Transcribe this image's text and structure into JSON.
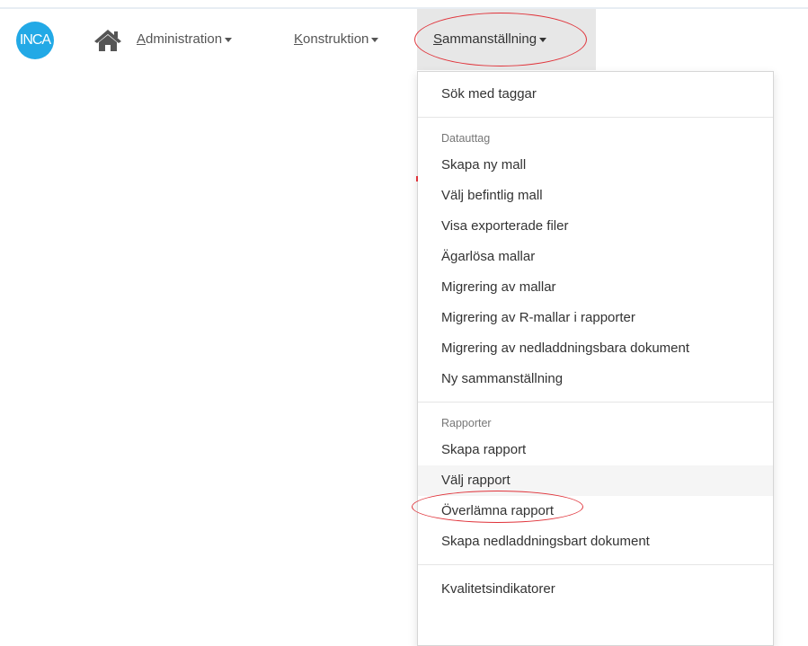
{
  "logo": {
    "text": "INCA"
  },
  "colors": {
    "logo": "#22a9e6",
    "annotation": "#e0333a",
    "active_nav_bg": "#e7e7e7"
  },
  "navbar": {
    "home_icon": "home-icon",
    "menus": [
      {
        "first": "A",
        "rest": "dministration"
      },
      {
        "first": "K",
        "rest": "onstruktion"
      },
      {
        "first": "S",
        "rest": "ammanställning"
      }
    ]
  },
  "dropdown": {
    "search_tags": "Sök med taggar",
    "datauttag": {
      "header": "Datauttag",
      "items": [
        "Skapa ny mall",
        "Välj befintlig mall",
        "Visa exporterade filer",
        "Ägarlösa mallar",
        "Migrering av mallar",
        "Migrering av R-mallar i rapporter",
        "Migrering av nedladdningsbara dokument",
        "Ny sammanställning"
      ]
    },
    "rapporter": {
      "header": "Rapporter",
      "items": [
        "Skapa rapport",
        "Välj rapport",
        "Överlämna rapport",
        "Skapa nedladdningsbart dokument"
      ]
    },
    "kvalitet": "Kvalitetsindikatorer"
  }
}
